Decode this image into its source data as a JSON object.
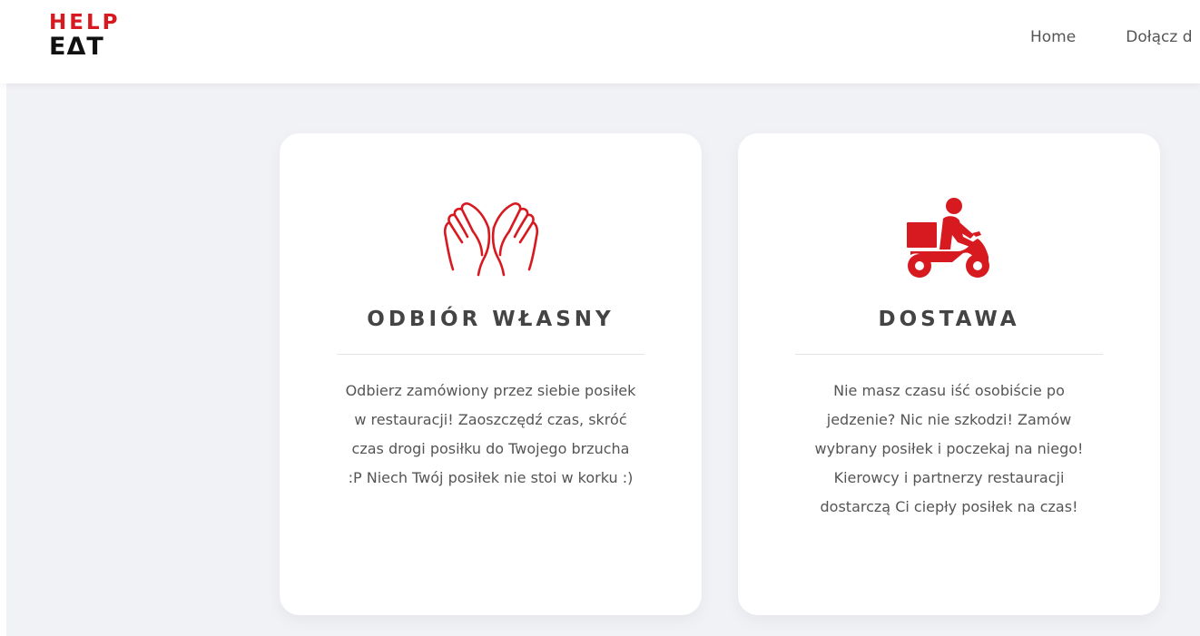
{
  "header": {
    "logo_top": "HELP",
    "logo_bottom": "EΔT",
    "nav": [
      "Home",
      "Dołącz d"
    ]
  },
  "colors": {
    "accent": "#d71920",
    "background": "#f1f2f6",
    "card": "#ffffff",
    "title_text": "#444444",
    "body_text": "#555555"
  },
  "cards": [
    {
      "icon": "open-hands-icon",
      "title": "ODBIÓR WŁASNY",
      "text": "Odbierz zamówiony przez siebie posiłek w restauracji! Zaoszczędź czas, skróć czas drogi posiłku do Twojego brzucha :P Niech Twój posiłek nie stoi w korku :)"
    },
    {
      "icon": "delivery-scooter-icon",
      "title": "DOSTAWA",
      "text": "Nie masz czasu iść osobiście po jedzenie? Nic nie szkodzi! Zamów wybrany posiłek i poczekaj na niego! Kierowcy i partnerzy restauracji dostarczą Ci ciepły posiłek na czas!"
    }
  ]
}
